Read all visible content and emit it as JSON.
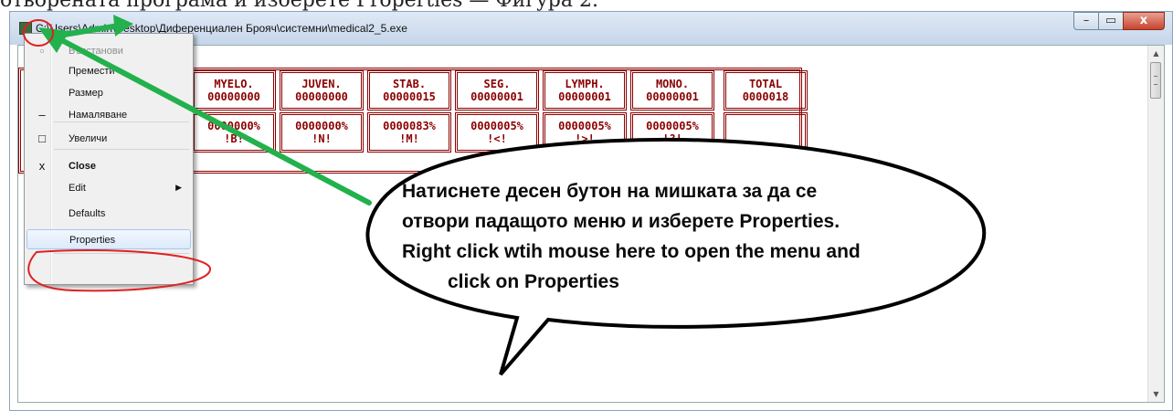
{
  "document": {
    "caption_fragment": "отворената програма и изберете Properties — Фигура 2."
  },
  "window": {
    "title": "C:\\Users\\Admin\\Desktop\\Диференциален Брояч\\системни\\medical2_5.exe",
    "buttons": {
      "minimize": "–",
      "maximize": "▭",
      "close": "x"
    }
  },
  "counter": {
    "columns": [
      {
        "name": "MYELO.",
        "count": "00000000",
        "percent": "0000000%",
        "key": "!B!"
      },
      {
        "name": "JUVEN.",
        "count": "00000000",
        "percent": "0000000%",
        "key": "!N!"
      },
      {
        "name": "STAB.",
        "count": "00000015",
        "percent": "0000083%",
        "key": "!M!"
      },
      {
        "name": "SEG.",
        "count": "00000001",
        "percent": "0000005%",
        "key": "!<!"
      },
      {
        "name": "LYMPH.",
        "count": "00000001",
        "percent": "0000005%",
        "key": "!>!"
      },
      {
        "name": "MONO.",
        "count": "00000001",
        "percent": "0000005%",
        "key": "!?!"
      }
    ],
    "total": {
      "name": "TOTAL",
      "count": "0000018"
    }
  },
  "menu": {
    "items": [
      {
        "label": "Възстанови",
        "glyph": "▫",
        "disabled": true
      },
      {
        "label": "Премести",
        "glyph": ""
      },
      {
        "label": "Размер",
        "glyph": ""
      },
      {
        "label": "Намаляване",
        "glyph": "–"
      },
      {
        "label": "Увеличи",
        "glyph": "□"
      },
      {
        "label": "Close",
        "glyph": "x",
        "bold": true
      },
      {
        "label": "Edit",
        "glyph": "",
        "submenu": true
      },
      {
        "label": "Defaults",
        "glyph": ""
      },
      {
        "label": "Properties",
        "glyph": "",
        "selected": true
      }
    ]
  },
  "callout": {
    "line1": "Натиснете десен бутон на мишката за да се",
    "line2": "отвори падащото меню и изберете Properties.",
    "line3": "Right click wtih mouse here to open the menu and",
    "line4": "click on Properties"
  },
  "colors": {
    "counter": "#8b0000",
    "arrow": "#22b14c",
    "annotation": "#e02020"
  },
  "icons": {
    "title": "console-app-icon",
    "submenu": "chevron-right-icon"
  }
}
